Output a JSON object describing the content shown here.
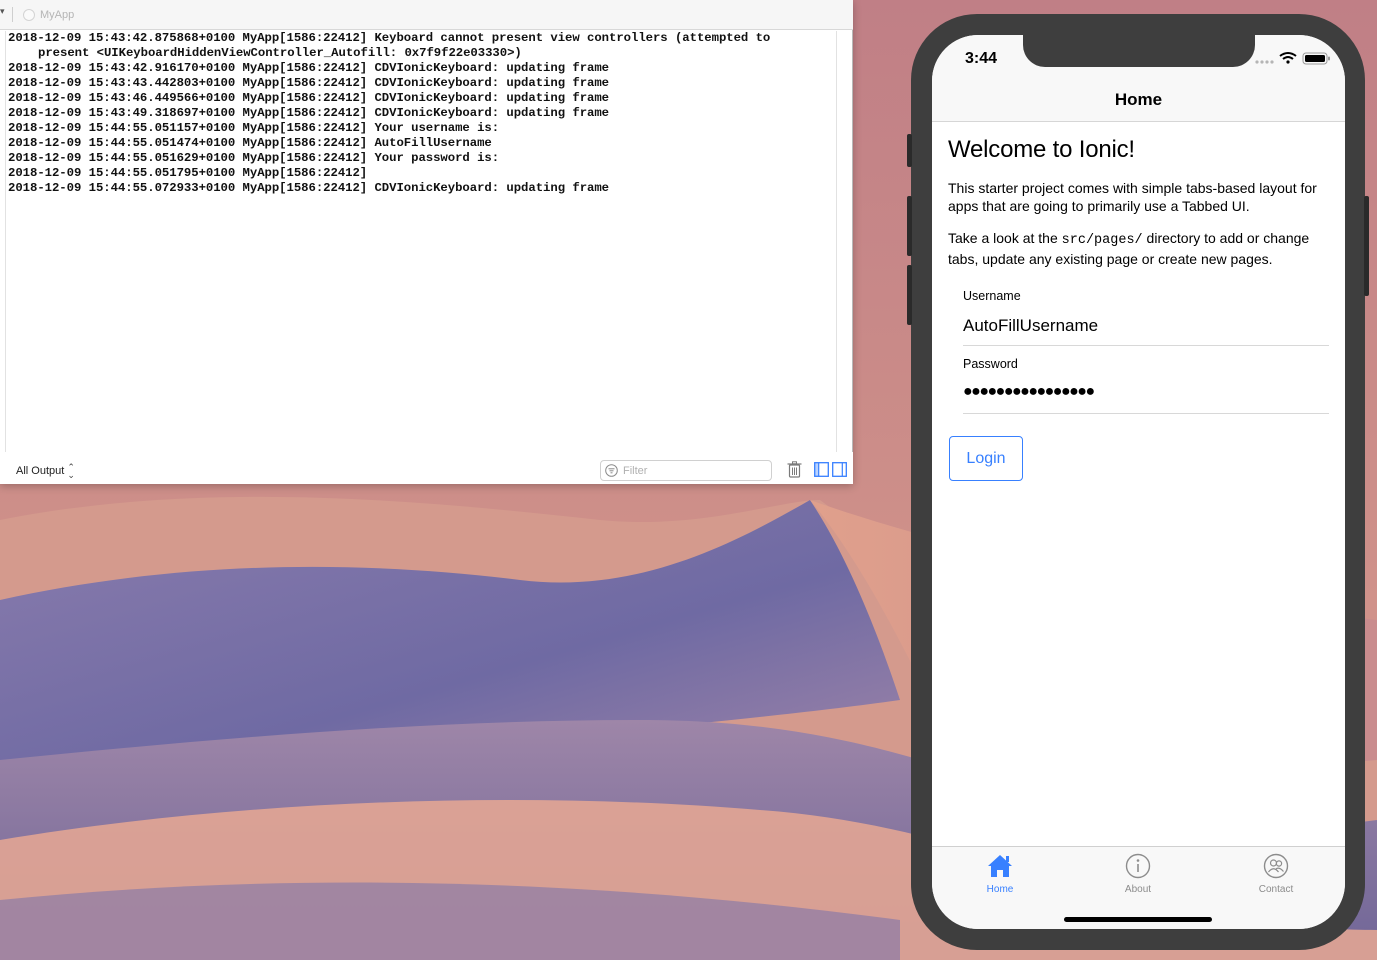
{
  "colors": {
    "accent": "#3880ff",
    "tab_inactive": "#8c8c8c",
    "phone_frame": "#3e3e3e"
  },
  "console": {
    "app_name": "MyApp",
    "log_lines": [
      "2018-12-09 15:43:42.875868+0100 MyApp[1586:22412] Keyboard cannot present view controllers (attempted to",
      "present <UIKeyboardHiddenViewController_Autofill: 0x7f9f22e03330>)",
      "2018-12-09 15:43:42.916170+0100 MyApp[1586:22412] CDVIonicKeyboard: updating frame",
      "2018-12-09 15:43:43.442803+0100 MyApp[1586:22412] CDVIonicKeyboard: updating frame",
      "2018-12-09 15:43:46.449566+0100 MyApp[1586:22412] CDVIonicKeyboard: updating frame",
      "2018-12-09 15:43:49.318697+0100 MyApp[1586:22412] CDVIonicKeyboard: updating frame",
      "2018-12-09 15:44:55.051157+0100 MyApp[1586:22412] Your username is:",
      "2018-12-09 15:44:55.051474+0100 MyApp[1586:22412] AutoFillUsername",
      "2018-12-09 15:44:55.051629+0100 MyApp[1586:22412] Your password is:",
      "2018-12-09 15:44:55.051795+0100 MyApp[1586:22412]",
      "2018-12-09 15:44:55.072933+0100 MyApp[1586:22412] CDVIonicKeyboard: updating frame"
    ],
    "output_select": "All Output",
    "filter_placeholder": "Filter",
    "icons": {
      "filter": "filter-icon",
      "trash": "trash-icon",
      "panel_left": "panel-left-icon",
      "panel_right": "panel-right-icon"
    }
  },
  "phone": {
    "status_time": "3:44",
    "nav_title": "Home",
    "welcome": "Welcome to Ionic!",
    "para1": "This starter project comes with simple tabs-based layout for apps that are going to primarily use a Tabbed UI.",
    "para2_before": "Take a look at the ",
    "para2_code": "src/pages/",
    "para2_after": " directory to add or change tabs, update any existing page or create new pages.",
    "username_label": "Username",
    "username_value": "AutoFillUsername",
    "password_label": "Password",
    "password_mask": "●●●●●●●●●●●●●●●●",
    "login_label": "Login",
    "tabs": [
      {
        "label": "Home",
        "icon": "home-icon",
        "active": true
      },
      {
        "label": "About",
        "icon": "info-icon",
        "active": false
      },
      {
        "label": "Contact",
        "icon": "contacts-icon",
        "active": false
      }
    ]
  }
}
